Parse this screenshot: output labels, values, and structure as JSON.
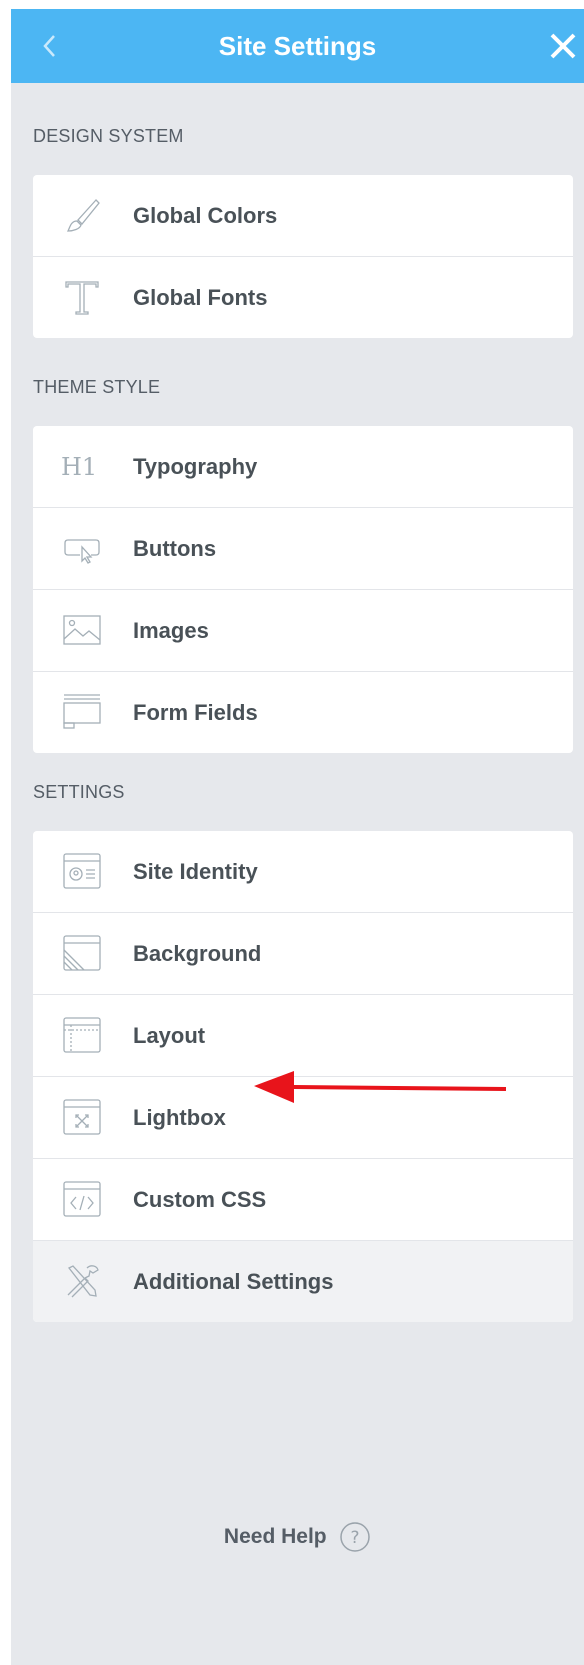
{
  "header": {
    "title": "Site Settings"
  },
  "sections": {
    "design_system": {
      "label": "DESIGN SYSTEM",
      "items": [
        {
          "label": "Global Colors",
          "icon": "brush-icon"
        },
        {
          "label": "Global Fonts",
          "icon": "font-t-icon"
        }
      ]
    },
    "theme_style": {
      "label": "THEME STYLE",
      "items": [
        {
          "label": "Typography",
          "icon": "h1-icon"
        },
        {
          "label": "Buttons",
          "icon": "button-cursor-icon"
        },
        {
          "label": "Images",
          "icon": "image-icon"
        },
        {
          "label": "Form Fields",
          "icon": "form-fields-icon"
        }
      ]
    },
    "settings": {
      "label": "SETTINGS",
      "items": [
        {
          "label": "Site Identity",
          "icon": "site-identity-icon"
        },
        {
          "label": "Background",
          "icon": "background-icon"
        },
        {
          "label": "Layout",
          "icon": "layout-icon"
        },
        {
          "label": "Lightbox",
          "icon": "lightbox-icon"
        },
        {
          "label": "Custom CSS",
          "icon": "code-icon"
        },
        {
          "label": "Additional Settings",
          "icon": "tools-icon"
        }
      ]
    }
  },
  "footer": {
    "help_text": "Need Help",
    "help_icon": "question-circle-icon"
  },
  "colors": {
    "header_bg": "#4cb6f3",
    "panel_bg": "#e6e8ec",
    "arrow": "#e8141b"
  }
}
